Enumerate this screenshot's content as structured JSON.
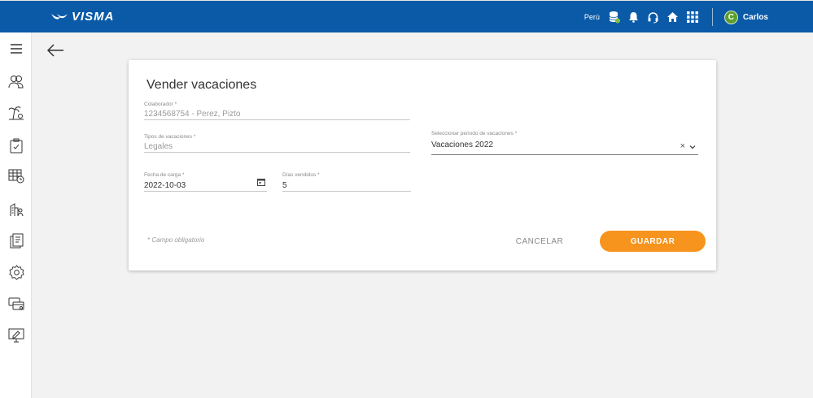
{
  "header": {
    "logo_text": "VISMA",
    "country": "Perú",
    "user_initial": "C",
    "user_name": "Carlos",
    "icons": [
      "database-icon",
      "bell-icon",
      "headset-icon",
      "home-icon",
      "apps-grid-icon"
    ],
    "bg_color": "#0a5aa8",
    "avatar_color": "#5c9e2e"
  },
  "sidebar": {
    "icons": [
      "menu-icon",
      "people-icon",
      "vacation-icon",
      "clipboard-icon",
      "calendar-grid-icon",
      "org-chart-icon",
      "documents-icon",
      "settings-icon",
      "cards-icon",
      "monitor-icon"
    ]
  },
  "form": {
    "title": "Vender vacaciones",
    "colaborador_label": "Colaborador *",
    "colaborador_value": "1234568754 - Perez, Pizto",
    "tipos_label": "Tipos de vacaciones *",
    "tipos_value": "Legales",
    "periodo_label": "Seleccionar periodo de vacaciones *",
    "periodo_value": "Vacaciones 2022",
    "fecha_label": "Fecha de carga *",
    "fecha_value": "2022-10-03",
    "dias_label": "Días vendidos *",
    "dias_value": "5",
    "required_note": "* Campo obligatorio",
    "cancel_label": "CANCELAR",
    "save_label": "GUARDAR",
    "accent_color": "#f7941d"
  }
}
